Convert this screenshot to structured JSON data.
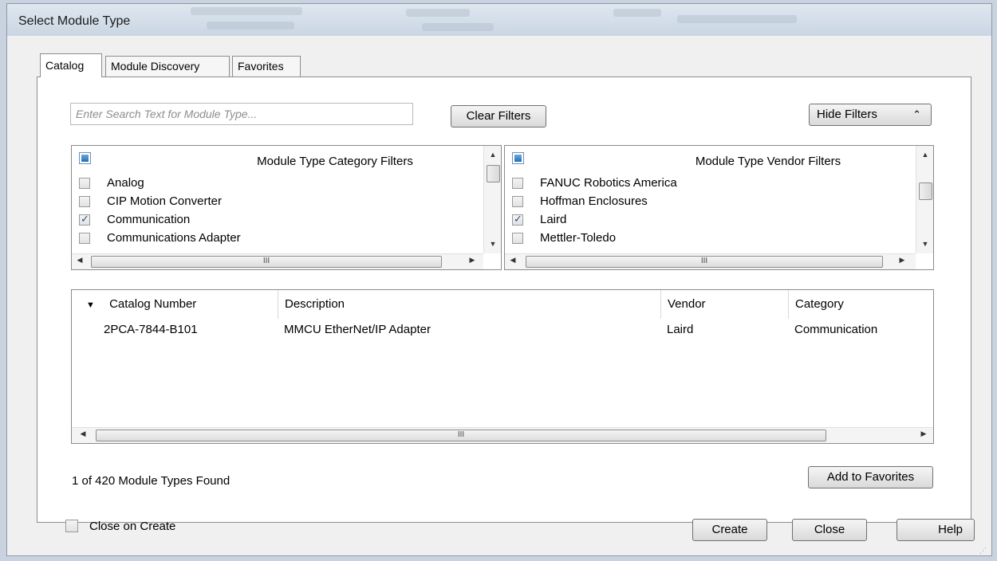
{
  "window": {
    "title": "Select Module Type"
  },
  "tabs": [
    {
      "label": "Catalog",
      "active": true
    },
    {
      "label": "Module Discovery",
      "active": false
    },
    {
      "label": "Favorites",
      "active": false
    }
  ],
  "search": {
    "placeholder": "Enter Search Text for Module Type..."
  },
  "buttons": {
    "clear_filters": "Clear Filters",
    "hide_filters": "Hide Filters",
    "hide_filters_icon": "double-chevron-up-icon",
    "add_to_favorites": "Add to Favorites",
    "create": "Create",
    "close": "Close",
    "help": "Help"
  },
  "category_filters": {
    "header": "Module Type Category Filters",
    "items": [
      {
        "label": "Analog",
        "checked": false
      },
      {
        "label": "CIP Motion Converter",
        "checked": false
      },
      {
        "label": "Communication",
        "checked": true
      },
      {
        "label": "Communications Adapter",
        "checked": false
      }
    ]
  },
  "vendor_filters": {
    "header": "Module Type Vendor Filters",
    "items": [
      {
        "label": "FANUC Robotics America",
        "checked": false
      },
      {
        "label": "Hoffman Enclosures",
        "checked": false
      },
      {
        "label": "Laird",
        "checked": true
      },
      {
        "label": "Mettler-Toledo",
        "checked": false
      }
    ]
  },
  "results": {
    "columns": [
      "Catalog Number",
      "Description",
      "Vendor",
      "Category"
    ],
    "sort_icon": "sort-descending-icon",
    "rows": [
      [
        "2PCA-7844-B101",
        "MMCU EtherNet/IP Adapter",
        "Laird",
        "Communication"
      ]
    ]
  },
  "status": "1 of 420 Module Types Found",
  "close_on_create": {
    "label": "Close on Create",
    "checked": false
  },
  "scrollbar_glyph": "III"
}
